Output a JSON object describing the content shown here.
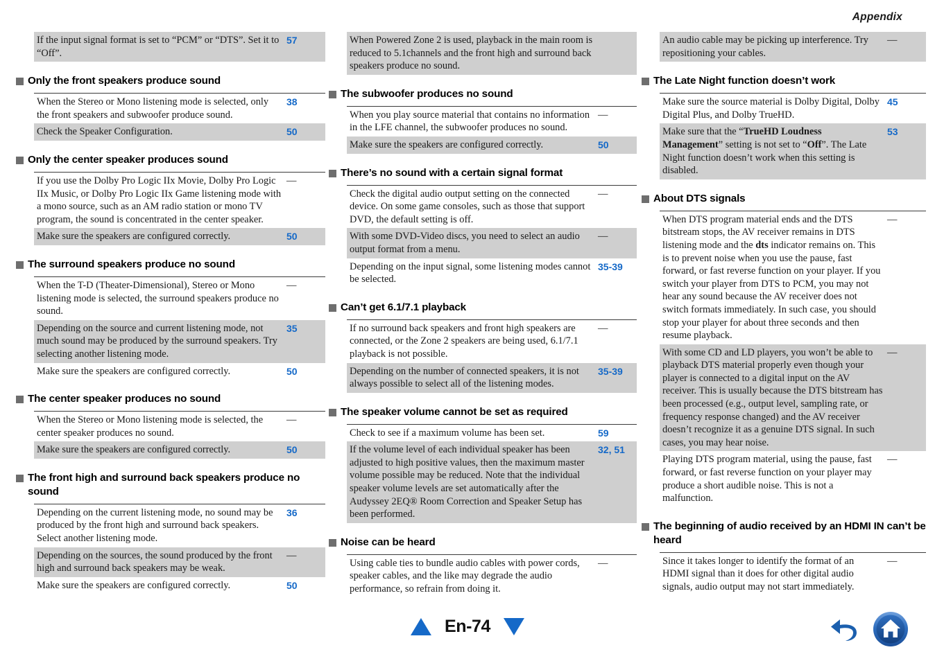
{
  "header": {
    "title": "Appendix"
  },
  "footer": {
    "page_label": "En-74",
    "up_arrow": "triangle-up",
    "down_arrow": "triangle-down",
    "back_icon": "back-arrow-icon",
    "home_icon": "home-icon"
  },
  "columns": [
    {
      "id": "column-1",
      "blocks": [
        {
          "type": "table-continued",
          "rows": [
            {
              "desc": "If the input signal format is set to “PCM” or “DTS”. Set it to “Off”.",
              "page": "57",
              "shaded": true
            }
          ]
        },
        {
          "type": "section",
          "heading": "Only the front speakers produce sound",
          "rows": [
            {
              "desc": "When the Stereo or Mono listening mode is selected, only the front speakers and subwoofer produce sound.",
              "page": "38",
              "shaded": false
            },
            {
              "desc": "Check the Speaker Configuration.",
              "page": "50",
              "shaded": true
            }
          ]
        },
        {
          "type": "section",
          "heading": "Only the center speaker produces sound",
          "rows": [
            {
              "desc": "If you use the Dolby Pro Logic IIx Movie, Dolby Pro Logic IIx Music, or Dolby Pro Logic IIx Game listening mode with a mono source, such as an AM radio station or mono TV program, the sound is concentrated in the center speaker.",
              "page": "—",
              "shaded": false
            },
            {
              "desc": "Make sure the speakers are configured correctly.",
              "page": "50",
              "shaded": true
            }
          ]
        },
        {
          "type": "section",
          "heading": "The surround speakers produce no sound",
          "rows": [
            {
              "desc": "When the T-D (Theater-Dimensional), Stereo or Mono listening mode is selected, the surround speakers produce no sound.",
              "page": "—",
              "shaded": false
            },
            {
              "desc": "Depending on the source and current listening mode, not much sound may be produced by the surround speakers. Try selecting another listening mode.",
              "page": "35",
              "shaded": true
            },
            {
              "desc": "Make sure the speakers are configured correctly.",
              "page": "50",
              "shaded": false
            }
          ]
        },
        {
          "type": "section",
          "heading": "The center speaker produces no sound",
          "rows": [
            {
              "desc": "When the Stereo or Mono listening mode is selected, the center speaker produces no sound.",
              "page": "—",
              "shaded": false
            },
            {
              "desc": "Make sure the speakers are configured correctly.",
              "page": "50",
              "shaded": true
            }
          ]
        },
        {
          "type": "section",
          "heading": "The front high and surround back speakers produce no sound",
          "rows": [
            {
              "desc": "Depending on the current listening mode, no sound may be produced by the front high and surround back speakers. Select another listening mode.",
              "page": "36",
              "shaded": false
            },
            {
              "desc": "Depending on the sources, the sound produced by the front high and surround back speakers may be weak.",
              "page": "—",
              "shaded": true
            },
            {
              "desc": "Make sure the speakers are configured correctly.",
              "page": "50",
              "shaded": false
            }
          ]
        }
      ]
    },
    {
      "id": "column-2",
      "blocks": [
        {
          "type": "table-continued",
          "rows": [
            {
              "desc": "When Powered Zone 2 is used, playback in the main room is reduced to 5.1channels and the front high and surround back speakers produce no sound.",
              "page": "",
              "shaded": true
            }
          ]
        },
        {
          "type": "section",
          "heading": "The subwoofer produces no sound",
          "rows": [
            {
              "desc": "When you play source material that contains no information in the LFE channel, the subwoofer produces no sound.",
              "page": "—",
              "shaded": false
            },
            {
              "desc": "Make sure the speakers are configured correctly.",
              "page": "50",
              "shaded": true
            }
          ]
        },
        {
          "type": "section",
          "heading": "There’s no sound with a certain signal format",
          "rows": [
            {
              "desc": "Check the digital audio output setting on the connected device. On some game consoles, such as those that support DVD, the default setting is off.",
              "page": "—",
              "shaded": false
            },
            {
              "desc": "With some DVD-Video discs, you need to select an audio output format from a menu.",
              "page": "—",
              "shaded": true
            },
            {
              "desc": "Depending on the input signal, some listening modes cannot be selected.",
              "page": "35-39",
              "shaded": false
            }
          ]
        },
        {
          "type": "section",
          "heading": "Can’t get 6.1/7.1 playback",
          "rows": [
            {
              "desc": "If no surround back speakers and front high speakers are connected, or the Zone 2 speakers are being used, 6.1/7.1 playback is not possible.",
              "page": "—",
              "shaded": false
            },
            {
              "desc": "Depending on the number of connected speakers, it is not always possible to select all of the listening modes.",
              "page": "35-39",
              "shaded": true
            }
          ]
        },
        {
          "type": "section",
          "heading": "The speaker volume cannot be set as required",
          "rows": [
            {
              "desc": "Check to see if a maximum volume has been set.",
              "page": "59",
              "shaded": false
            },
            {
              "desc": "If the volume level of each individual speaker has been adjusted to high positive values, then the maximum master volume possible may be reduced. Note that the individual speaker volume levels are set automatically after the Audyssey 2EQ® Room Correction and Speaker Setup has been performed.",
              "page": "32, 51",
              "shaded": true
            }
          ]
        },
        {
          "type": "section",
          "heading": "Noise can be heard",
          "rows": [
            {
              "desc": "Using cable ties to bundle audio cables with power cords, speaker cables, and the like may degrade the audio performance, so refrain from doing it.",
              "page": "—",
              "shaded": false
            }
          ]
        }
      ]
    },
    {
      "id": "column-3",
      "blocks": [
        {
          "type": "table-continued",
          "rows": [
            {
              "desc": "An audio cable may be picking up interference. Try repositioning your cables.",
              "page": "—",
              "shaded": true
            }
          ]
        },
        {
          "type": "section",
          "heading": "The Late Night function doesn’t work",
          "rows": [
            {
              "desc": "Make sure the source material is Dolby Digital, Dolby Digital Plus, and Dolby TrueHD.",
              "page": "45",
              "shaded": false
            },
            {
              "desc": "Make sure that the “TrueHD Loudness Management” setting is not set to “Off”. The Late Night function doesn’t work when this setting is disabled.",
              "page": "53",
              "shaded": true,
              "bold_spans": [
                "TrueHD Loudness Management",
                "Off"
              ]
            }
          ]
        },
        {
          "type": "section",
          "heading": "About DTS signals",
          "rows": [
            {
              "desc": "When DTS program material ends and the DTS bitstream stops, the AV receiver remains in DTS listening mode and the dts indicator remains on. This is to prevent noise when you use the pause, fast forward, or fast reverse function on your player. If you switch your player from DTS to PCM, you may not hear any sound because the AV receiver does not switch formats immediately. In such case, you should stop your player for about three seconds and then resume playback.",
              "page": "—",
              "shaded": false,
              "bold_spans": [
                "dts"
              ]
            },
            {
              "desc": "With some CD and LD players, you won’t be able to playback DTS material properly even though your player is connected to a digital input on the AV receiver. This is usually because the DTS bitstream has been processed (e.g., output level, sampling rate, or frequency response changed) and the AV receiver doesn’t recognize it as a genuine DTS signal. In such cases, you may hear noise.",
              "page": "—",
              "shaded": true
            },
            {
              "desc": "Playing DTS program material, using the pause, fast forward, or fast reverse function on your player may produce a short audible noise. This is not a malfunction.",
              "page": "—",
              "shaded": false
            }
          ]
        },
        {
          "type": "section",
          "heading": "The beginning of audio received by an HDMI IN can’t be heard",
          "rows": [
            {
              "desc": "Since it takes longer to identify the format of an HDMI signal than it does for other digital audio signals, audio output may not start immediately.",
              "page": "—",
              "shaded": false
            }
          ]
        }
      ]
    }
  ],
  "colors": {
    "accent_blue": "#1569c8",
    "shade_gray": "#cfcfcf",
    "bullet_gray": "#6e6e6e",
    "rule_dark": "#3a3a3a"
  }
}
